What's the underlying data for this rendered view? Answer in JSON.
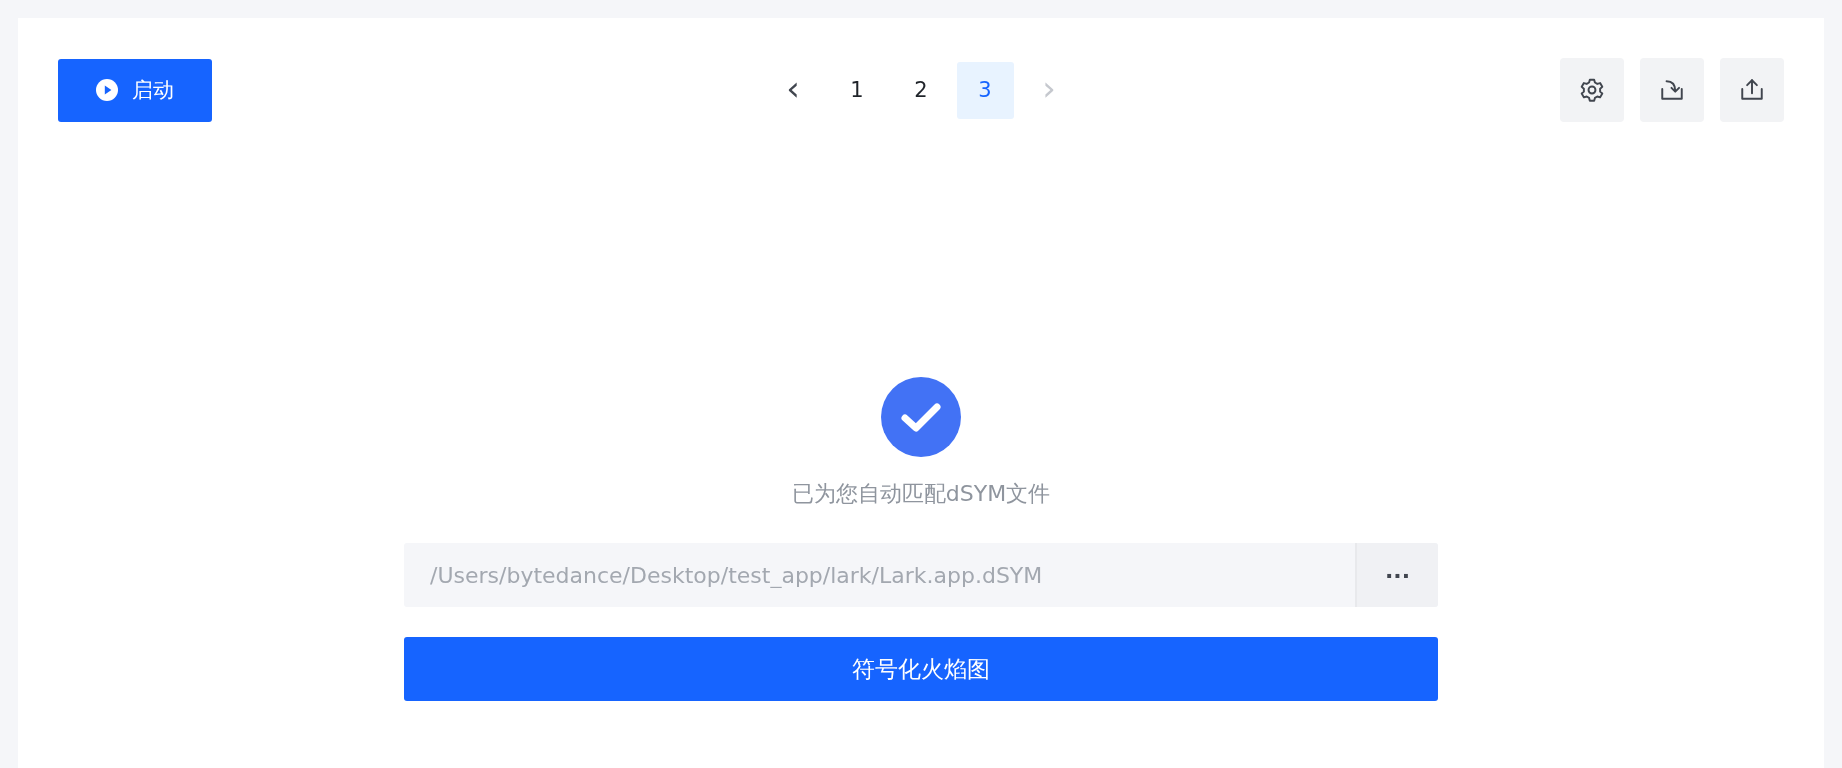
{
  "toolbar": {
    "start_button": {
      "label": "启动"
    },
    "pagination": {
      "prev": {
        "label": "‹",
        "disabled": false
      },
      "next": {
        "label": "›",
        "disabled": true
      },
      "pages": [
        {
          "label": "1",
          "selected": false
        },
        {
          "label": "2",
          "selected": false
        },
        {
          "label": "3",
          "selected": true
        }
      ]
    },
    "actions": [
      {
        "kind": "settings"
      },
      {
        "kind": "import"
      },
      {
        "kind": "export"
      }
    ]
  },
  "result": {
    "message": "已为您自动匹配dSYM文件"
  },
  "path_field": {
    "placeholder": "/Users/bytedance/Desktop/test_app/lark/Lark.app.dSYM",
    "browse_label": "···"
  },
  "submit_button": {
    "label": "符号化火焰图"
  }
}
